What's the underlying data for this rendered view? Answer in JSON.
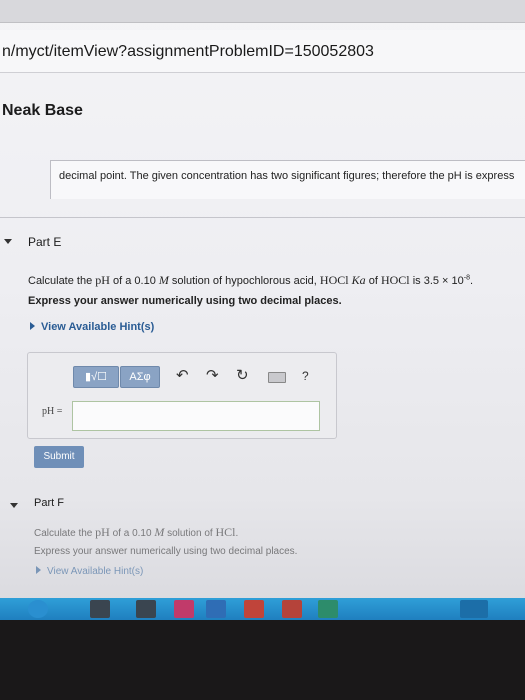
{
  "browser": {
    "url": "n/myct/itemView?assignmentProblemID=150052803"
  },
  "page": {
    "section_title": "Neak Base",
    "explanation": "decimal point. The given concentration has two significant figures; therefore the pH is express"
  },
  "part_e": {
    "label": "Part E",
    "question_prefix": "Calculate the ",
    "question_ph": "pH",
    "question_mid": " of a 0.10 ",
    "question_m": "M",
    "question_mid2": " solution of hypochlorous acid, ",
    "question_hocl": "HOCl",
    "question_ka": "Ka",
    "question_mid3": " of ",
    "question_hocl2": "HOCl",
    "question_mid4": " is 3.5 × 10",
    "question_exp": "-8",
    "question_end": ".",
    "instruction": "Express your answer numerically using two decimal places.",
    "hint": "View Available Hint(s)",
    "toolbar": {
      "templates_label": "▮√☐",
      "symbols_label": "ΑΣφ",
      "undo_glyph": "↶",
      "redo_glyph": "↷",
      "reset_glyph": "↻",
      "help_glyph": "?"
    },
    "answer_label": "pH =",
    "answer_value": "",
    "submit": "Submit"
  },
  "part_f": {
    "label": "Part F",
    "question_prefix": "Calculate the ",
    "question_ph": "pH",
    "question_mid": " of a 0.10 ",
    "question_m": "M",
    "question_mid2": " solution of ",
    "question_hcl": "HCl",
    "question_end": ".",
    "instruction": "Express your answer numerically using two decimal places.",
    "hint": "View Available Hint(s)"
  },
  "taskbar": {
    "apps": [
      "chrome-icon",
      "folder-icon",
      "calendar-icon",
      "mail-icon",
      "word-icon",
      "media-icon",
      "powerpoint-icon",
      "store-icon",
      "office-icon"
    ],
    "accent": "#2a9ad6"
  }
}
